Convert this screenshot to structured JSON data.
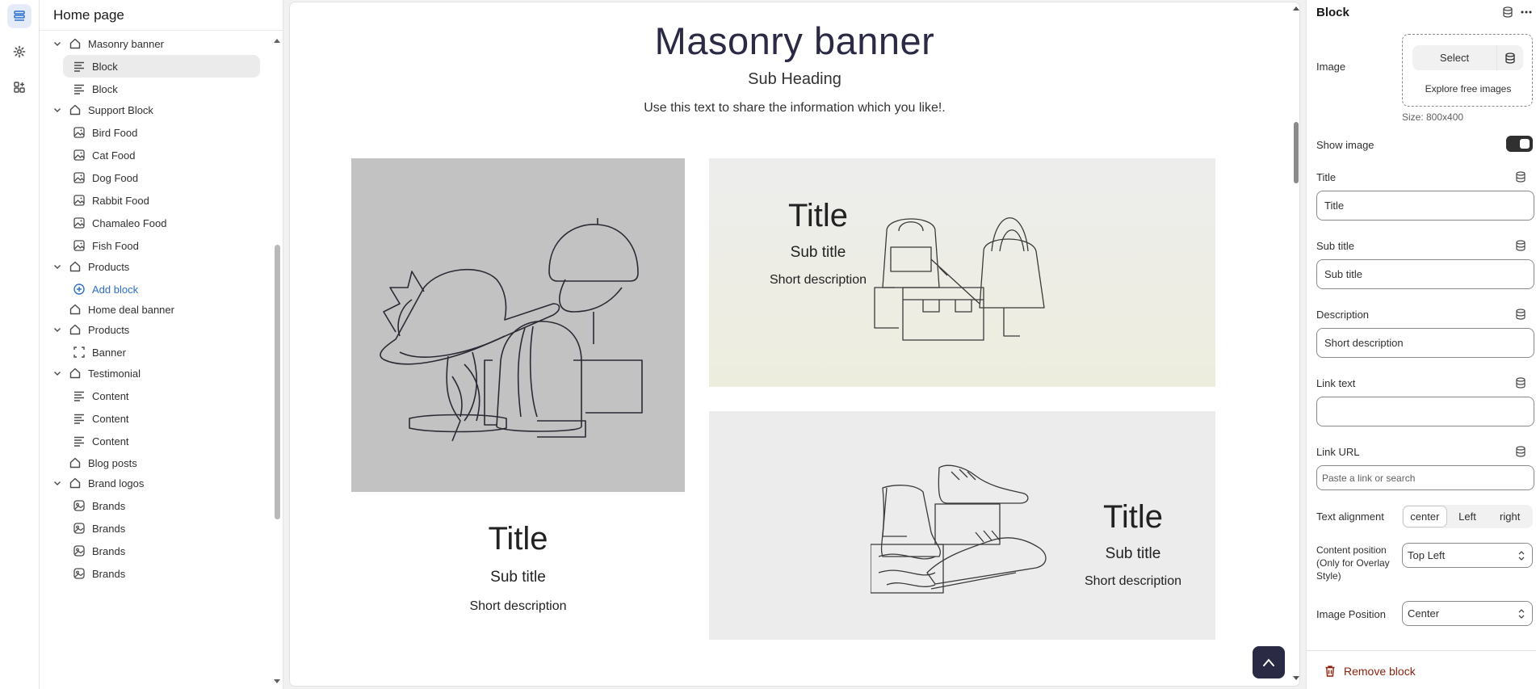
{
  "sidebar": {
    "title": "Home page",
    "items": [
      {
        "label": "Masonry banner",
        "level": 0,
        "icon": "section-icon",
        "expand": true
      },
      {
        "label": "Block",
        "level": 1,
        "icon": "text-block-icon",
        "selected": true
      },
      {
        "label": "Block",
        "level": 1,
        "icon": "text-block-icon"
      },
      {
        "label": "Support Block",
        "level": 0,
        "icon": "section-icon",
        "expand": true
      },
      {
        "label": "Bird Food",
        "level": 1,
        "icon": "image-block-icon"
      },
      {
        "label": "Cat Food",
        "level": 1,
        "icon": "image-block-icon"
      },
      {
        "label": "Dog Food",
        "level": 1,
        "icon": "image-block-icon"
      },
      {
        "label": "Rabbit Food",
        "level": 1,
        "icon": "image-block-icon"
      },
      {
        "label": "Chamaleo Food",
        "level": 1,
        "icon": "image-block-icon"
      },
      {
        "label": "Fish Food",
        "level": 1,
        "icon": "image-block-icon"
      },
      {
        "label": "Products",
        "level": 0,
        "icon": "section-icon",
        "expand": true
      },
      {
        "label": "Add block",
        "level": 1,
        "icon": "add-circle-icon",
        "add": true
      },
      {
        "label": "Home deal banner",
        "level": 0,
        "icon": "section-icon",
        "expand": false
      },
      {
        "label": "Products",
        "level": 0,
        "icon": "section-icon",
        "expand": true
      },
      {
        "label": "Banner",
        "level": 1,
        "icon": "banner-block-icon"
      },
      {
        "label": "Testimonial",
        "level": 0,
        "icon": "section-icon",
        "expand": true
      },
      {
        "label": "Content",
        "level": 1,
        "icon": "text-block-icon"
      },
      {
        "label": "Content",
        "level": 1,
        "icon": "text-block-icon"
      },
      {
        "label": "Content",
        "level": 1,
        "icon": "text-block-icon"
      },
      {
        "label": "Blog posts",
        "level": 0,
        "icon": "section-icon",
        "expand": false
      },
      {
        "label": "Brand logos",
        "level": 0,
        "icon": "section-icon",
        "expand": true
      },
      {
        "label": "Brands",
        "level": 1,
        "icon": "brand-block-icon"
      },
      {
        "label": "Brands",
        "level": 1,
        "icon": "brand-block-icon"
      },
      {
        "label": "Brands",
        "level": 1,
        "icon": "brand-block-icon"
      },
      {
        "label": "Brands",
        "level": 1,
        "icon": "brand-block-icon"
      }
    ]
  },
  "preview": {
    "heading": "Masonry banner",
    "subheading": "Sub Heading",
    "description": "Use this text to share the information which you like!.",
    "cards": [
      {
        "title": "Title",
        "subtitle": "Sub title",
        "desc": "Short description",
        "image": "hats-illustration"
      },
      {
        "title": "Title",
        "subtitle": "Sub title",
        "desc": "Short description",
        "image": "bags-illustration"
      },
      {
        "title": "Title",
        "subtitle": "Sub title",
        "desc": "Short description",
        "image": "shoes-illustration"
      }
    ]
  },
  "panel": {
    "title": "Block",
    "image_label": "Image",
    "select_label": "Select",
    "explore_label": "Explore free images",
    "size_note": "Size: 800x400",
    "show_image_label": "Show image",
    "show_image_on": true,
    "title_label": "Title",
    "title_value": "Title",
    "subtitle_label": "Sub title",
    "subtitle_value": "Sub title",
    "description_label": "Description",
    "description_value": "Short description",
    "link_text_label": "Link text",
    "link_text_value": "",
    "link_url_label": "Link URL",
    "link_url_placeholder": "Paste a link or search",
    "text_alignment_label": "Text alignment",
    "alignment_options": [
      "center",
      "Left",
      "right"
    ],
    "alignment_selected": "center",
    "content_position_label_1": "Content position",
    "content_position_label_2": "(Only for Overlay",
    "content_position_label_3": "Style)",
    "content_position_value": "Top Left",
    "image_position_label": "Image Position",
    "image_position_value": "Center",
    "remove_label": "Remove block"
  },
  "colors": {
    "accent": "#2c6ecb",
    "dark": "#2a2a45",
    "danger": "#8e1f0b",
    "card_gray": "#c2c2c2",
    "card_cream": "#eeeee6",
    "card_light": "#ececec"
  }
}
